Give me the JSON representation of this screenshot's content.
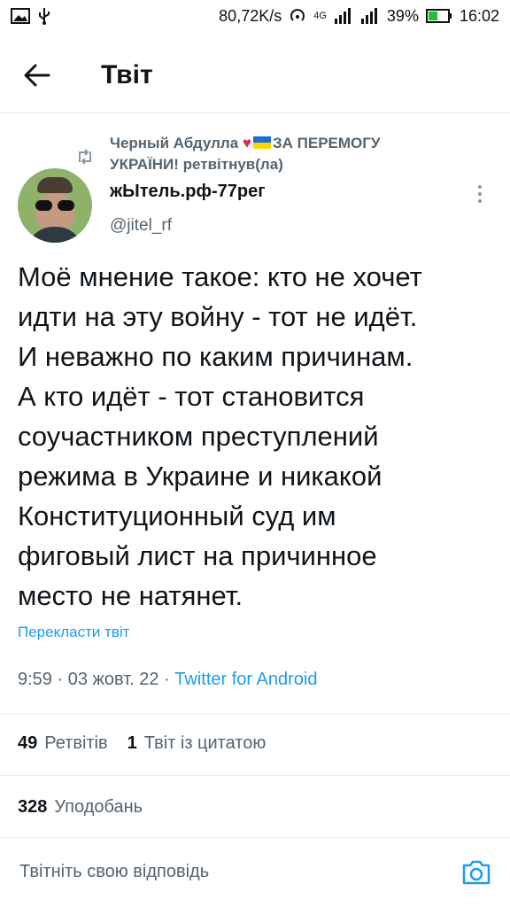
{
  "status_bar": {
    "speed": "80,72K/s",
    "network": "4G",
    "battery": "39%",
    "time": "16:02"
  },
  "header": {
    "title": "Твіт"
  },
  "retweet": {
    "prefix": "Черный Абдулла ",
    "suffix": "ЗА ПЕРЕМОГУ УКРАЇНИ! ретвітнув(ла)"
  },
  "author": {
    "name": "жЫтель.рф-77рег",
    "handle": "@jitel_rf"
  },
  "tweet": {
    "text": "Моё мнение такое: кто не хочет\nидти на эту войну - тот не идёт.\nИ неважно по каким причинам.\nА кто идёт - тот становится\nсоучастником преступлений\nрежима в Украине и никакой\nКонституционный суд им\nфиговый лист на причинное\nместо не натянет.",
    "translate_label": "Перекласти твіт",
    "timestamp": "9:59 · 03 жовт. 22 · ",
    "source": "Twitter for Android"
  },
  "stats": {
    "retweets_count": "49",
    "retweets_label": "Ретвітів",
    "quotes_count": "1",
    "quotes_label": "Твіт із цитатою",
    "likes_count": "328",
    "likes_label": "Уподобань"
  },
  "reply": {
    "placeholder": "Твітніть свою відповідь"
  },
  "colors": {
    "accent": "#1d9bf0",
    "secondary_text": "#536471",
    "divider": "#e6ecf0"
  }
}
